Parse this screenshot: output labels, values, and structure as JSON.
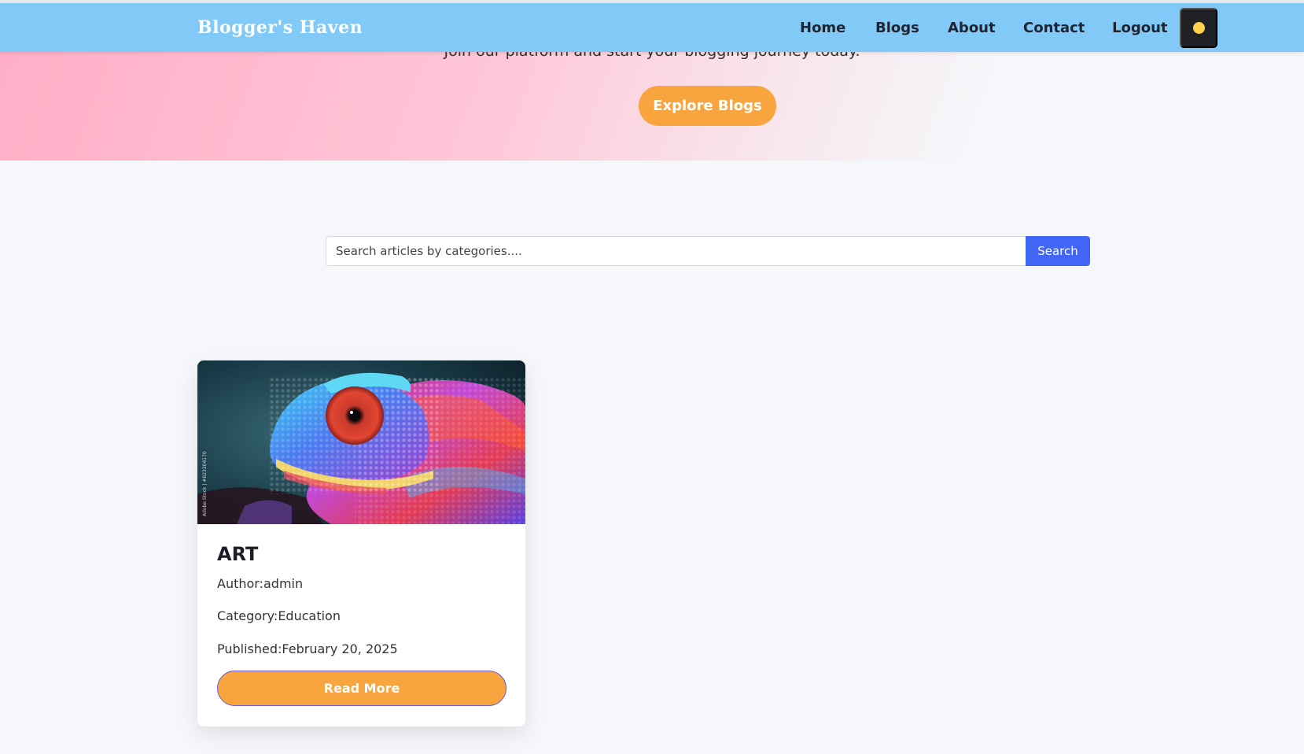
{
  "nav": {
    "brand": "Blogger's Haven",
    "links": [
      "Home",
      "Blogs",
      "About",
      "Contact",
      "Logout"
    ],
    "theme_icon": "sun-icon"
  },
  "hero": {
    "subtitle": "Join our platform and start your blogging journey today.",
    "explore_label": "Explore Blogs"
  },
  "search": {
    "placeholder": "Search articles by categories....",
    "button_label": "Search"
  },
  "articles": [
    {
      "title": "ART",
      "author": "Author:admin",
      "category": "Category:Education",
      "published": "Published:February 20, 2025",
      "read_more": "Read More",
      "image": "chameleon-image",
      "watermark": "Adobe Stock | #823304170"
    }
  ],
  "colors": {
    "nav_bg": "#81caf7",
    "accent": "#f9a53f",
    "search_btn": "#4166f5",
    "hero_pink": "#ffadc6"
  }
}
